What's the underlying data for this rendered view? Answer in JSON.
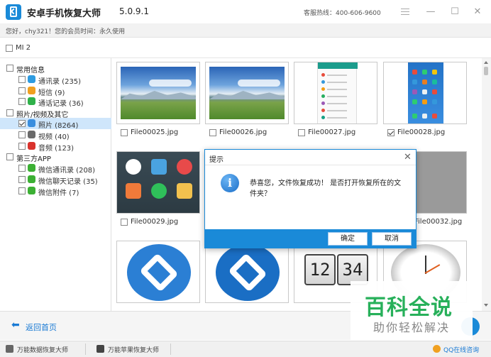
{
  "app": {
    "title": "安卓手机恢复大师",
    "version": "5.0.9.1",
    "hotline": "客服热线：400-606-9600",
    "member_text": "您好，chy321！您的会员时间：永久使用"
  },
  "device": {
    "name": "MI 2"
  },
  "sidebar": {
    "categories": [
      {
        "label": "常用信息",
        "items": [
          {
            "label": "通讯录 (235)",
            "icon": "contacts-icon",
            "color": "#2d9be0"
          },
          {
            "label": "短信 (9)",
            "icon": "sms-icon",
            "color": "#f0a020"
          },
          {
            "label": "通话记录 (36)",
            "icon": "phone-icon",
            "color": "#2fb14a"
          }
        ]
      },
      {
        "label": "照片/视频及其它",
        "items": [
          {
            "label": "照片 (8264)",
            "icon": "photo-icon",
            "color": "#3a8ede"
          },
          {
            "label": "视频 (40)",
            "icon": "video-icon",
            "color": "#6a6a6a"
          },
          {
            "label": "音频 (123)",
            "icon": "audio-icon",
            "color": "#d9332d"
          }
        ]
      },
      {
        "label": "第三方APP",
        "items": [
          {
            "label": "微信通讯录 (208)",
            "icon": "wechat-icon",
            "color": "#3cb034"
          },
          {
            "label": "微信聊天记录 (35)",
            "icon": "wechat-icon",
            "color": "#3cb034"
          },
          {
            "label": "微信附件 (7)",
            "icon": "wechat-icon",
            "color": "#3cb034"
          }
        ]
      }
    ]
  },
  "files": [
    {
      "name": "File00025.jpg",
      "checked": false
    },
    {
      "name": "File00026.jpg",
      "checked": false
    },
    {
      "name": "File00027.jpg",
      "checked": false
    },
    {
      "name": "File00028.jpg",
      "checked": true
    },
    {
      "name": "File00029.jpg",
      "checked": false
    },
    {
      "name": "File00032.jpg",
      "checked": false
    }
  ],
  "clock": {
    "hours": "12",
    "minutes": "34"
  },
  "bottom": {
    "back_label": "返回首页"
  },
  "footer": {
    "item1": "万能数据恢复大师",
    "item2": "万能苹果恢复大师",
    "qq": "QQ在线咨询"
  },
  "dialog": {
    "title": "提示",
    "message": "恭喜您，文件恢复成功！ 是否打开恢复所在的文件夹？",
    "ok": "确定",
    "cancel": "取消"
  },
  "watermark": {
    "logo": "百科全说",
    "slogan": "助你轻松解决"
  },
  "colors": {
    "accent": "#1a8ad8",
    "selection": "#cfe6fb",
    "watermark_green": "#27b05a"
  }
}
